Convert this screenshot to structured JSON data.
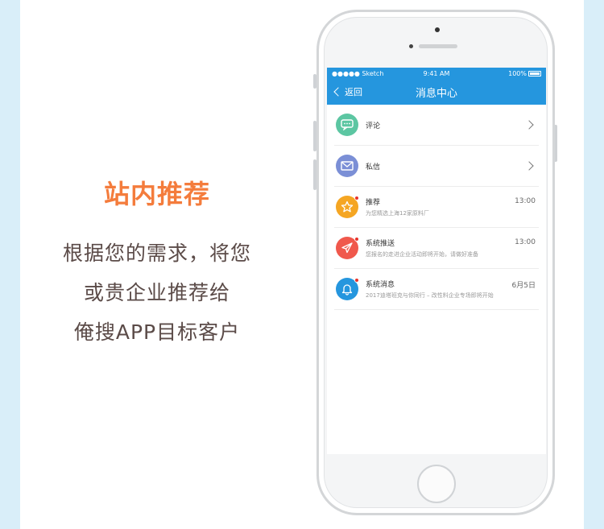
{
  "promo": {
    "headline": "站内推荐",
    "line1": "根据您的需求，将您",
    "line2": "或贵企业推荐给",
    "line3": "俺搜APP目标客户"
  },
  "statusbar": {
    "carrier": "●●●●● Sketch",
    "time": "9:41 AM",
    "battery": "100%"
  },
  "navbar": {
    "back_label": "返回",
    "title": "消息中心"
  },
  "colors": {
    "nav_blue": "#2596de",
    "accent_orange": "#f47c3c",
    "comment_teal": "#5cc6a2",
    "mail_purple": "#7b8fd6",
    "star_orange": "#f5a623",
    "push_red": "#f0584c",
    "bell_blue": "#2596de"
  },
  "messages": [
    {
      "icon": "comment-icon",
      "title": "评论"
    },
    {
      "icon": "mail-icon",
      "title": "私信"
    },
    {
      "icon": "star-icon",
      "title": "推荐",
      "subtitle": "为您精选上海12家原料厂",
      "time": "13:00"
    },
    {
      "icon": "paper-plane-icon",
      "title": "系统推送",
      "subtitle": "您报名的走进企业活动即将开始，请做好准备",
      "time": "13:00"
    },
    {
      "icon": "bell-icon",
      "title": "系统消息",
      "subtitle": "2017迪塔班克与你同行 – 改性料企业专场即将开始",
      "time": "6月5日"
    }
  ]
}
